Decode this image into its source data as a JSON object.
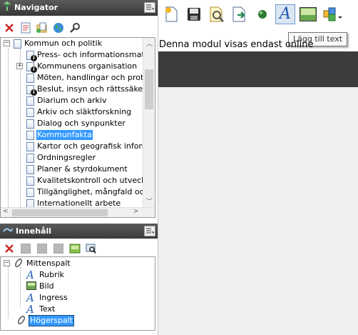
{
  "navigator": {
    "title": "Navigator",
    "tree": [
      {
        "label": "Kommun och politik",
        "state": "expanded",
        "info": false
      },
      {
        "label": "Press- och informationsmateri",
        "state": "leaf",
        "info": true
      },
      {
        "label": "Kommunens organisation",
        "state": "collapsed",
        "info": true
      },
      {
        "label": "Möten, handlingar och protok",
        "state": "leaf",
        "info": false
      },
      {
        "label": "Beslut, insyn och rättssäkerhe",
        "state": "leaf",
        "info": true
      },
      {
        "label": "Diarium och arkiv",
        "state": "leaf",
        "info": false
      },
      {
        "label": "Arkiv och släktforskning",
        "state": "leaf",
        "info": false
      },
      {
        "label": "Dialog och synpunkter",
        "state": "leaf",
        "info": false
      },
      {
        "label": "Kommunfakta",
        "state": "leaf",
        "info": false,
        "selected": true
      },
      {
        "label": "Kartor och geografisk informa",
        "state": "leaf",
        "info": false
      },
      {
        "label": "Ordningsregler",
        "state": "leaf",
        "info": false
      },
      {
        "label": "Planer & styrdokument",
        "state": "leaf",
        "info": false
      },
      {
        "label": "Kvalitetskontroll och utvecklin",
        "state": "leaf",
        "info": false
      },
      {
        "label": "Tillgänglighet, mångfald och ja",
        "state": "leaf",
        "info": false
      },
      {
        "label": "Internationellt arbete",
        "state": "leaf",
        "info": false
      }
    ]
  },
  "content": {
    "title": "Innehåll",
    "tree": [
      {
        "label": "Mittenspalt",
        "kind": "column",
        "expanded": true
      },
      {
        "label": "Rubrik",
        "kind": "text"
      },
      {
        "label": "Bild",
        "kind": "image"
      },
      {
        "label": "Ingress",
        "kind": "text"
      },
      {
        "label": "Text",
        "kind": "text"
      },
      {
        "label": "Högerspalt",
        "kind": "column",
        "selected": true
      }
    ]
  },
  "main": {
    "tooltip": "Lägg till text",
    "module_message": "Denna modul visas endast online"
  },
  "colors": {
    "header": "#3a3a3a",
    "selection": "#3399ff",
    "delete": "#cc2a2a",
    "dark_band": "#3c3c3c"
  }
}
